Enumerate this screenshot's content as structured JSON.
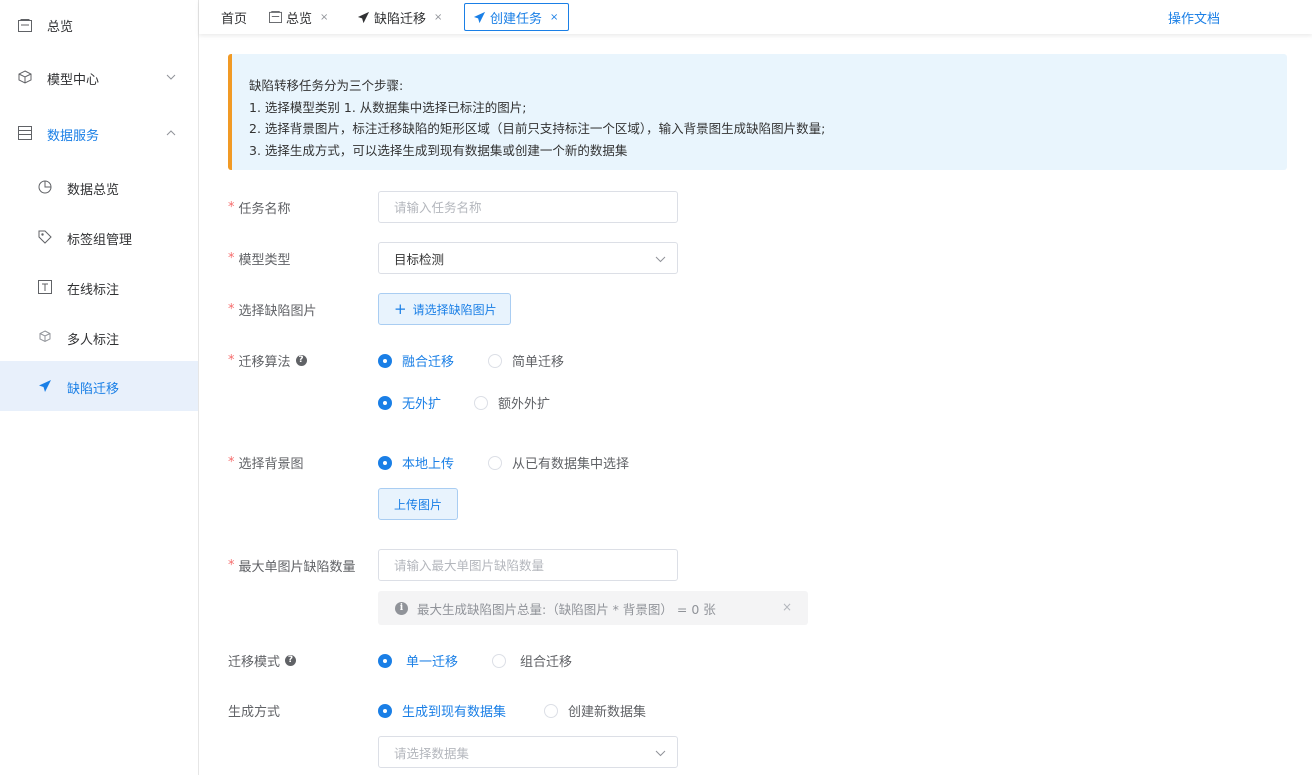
{
  "sidebar": {
    "items": [
      {
        "label": "总览",
        "icon": "overview-icon"
      },
      {
        "label": "模型中心",
        "icon": "cube-icon"
      },
      {
        "label": "数据服务",
        "icon": "database-icon"
      },
      {
        "label": "数据总览",
        "icon": "pie-chart-icon"
      },
      {
        "label": "标签组管理",
        "icon": "tag-icon"
      },
      {
        "label": "在线标注",
        "icon": "text-box-icon"
      },
      {
        "label": "多人标注",
        "icon": "boxes-icon"
      },
      {
        "label": "缺陷迁移",
        "icon": "paper-plane-icon"
      }
    ]
  },
  "tabs": [
    {
      "label": "首页"
    },
    {
      "label": "总览",
      "close": "×"
    },
    {
      "label": "缺陷迁移",
      "close": "×"
    },
    {
      "label": "创建任务",
      "close": "×"
    }
  ],
  "doc_link": "操作文档",
  "notice": {
    "lines": [
      "缺陷转移任务分为三个步骤:",
      "1. 选择模型类别 1. 从数据集中选择已标注的图片;",
      "2. 选择背景图片，标注迁移缺陷的矩形区域（目前只支持标注一个区域），输入背景图生成缺陷图片数量;",
      "3. 选择生成方式，可以选择生成到现有数据集或创建一个新的数据集"
    ]
  },
  "form": {
    "required_mark": "*",
    "task_name": {
      "label": "任务名称",
      "placeholder": "请输入任务名称"
    },
    "model_type": {
      "label": "模型类型",
      "value": "目标检测"
    },
    "defect_image": {
      "label": "选择缺陷图片",
      "button": "请选择缺陷图片",
      "button_plus": "+"
    },
    "algorithm": {
      "label": "迁移算法",
      "help": "?",
      "options_a": [
        "融合迁移",
        "简单迁移"
      ],
      "options_b": [
        "无外扩",
        "额外外扩"
      ]
    },
    "background": {
      "label": "选择背景图",
      "options": [
        "本地上传",
        "从已有数据集中选择"
      ],
      "upload_button": "上传图片"
    },
    "max_defects": {
      "label": "最大单图片缺陷数量",
      "placeholder": "请输入最大单图片缺陷数量",
      "info": "最大生成缺陷图片总量:（缺陷图片 * 背景图） =   0 张",
      "info_icon": "i",
      "info_close": "×"
    },
    "mode": {
      "label": "迁移模式",
      "help": "?",
      "options": [
        "单一迁移",
        "组合迁移"
      ]
    },
    "generate": {
      "label": "生成方式",
      "options": [
        "生成到现有数据集",
        "创建新数据集"
      ],
      "dataset_placeholder": "请选择数据集"
    }
  },
  "colors": {
    "accent": "#1a7fe6",
    "warning_bar": "#f19a25",
    "notice_bg": "#e9f5fd",
    "required": "#f56c6c"
  }
}
